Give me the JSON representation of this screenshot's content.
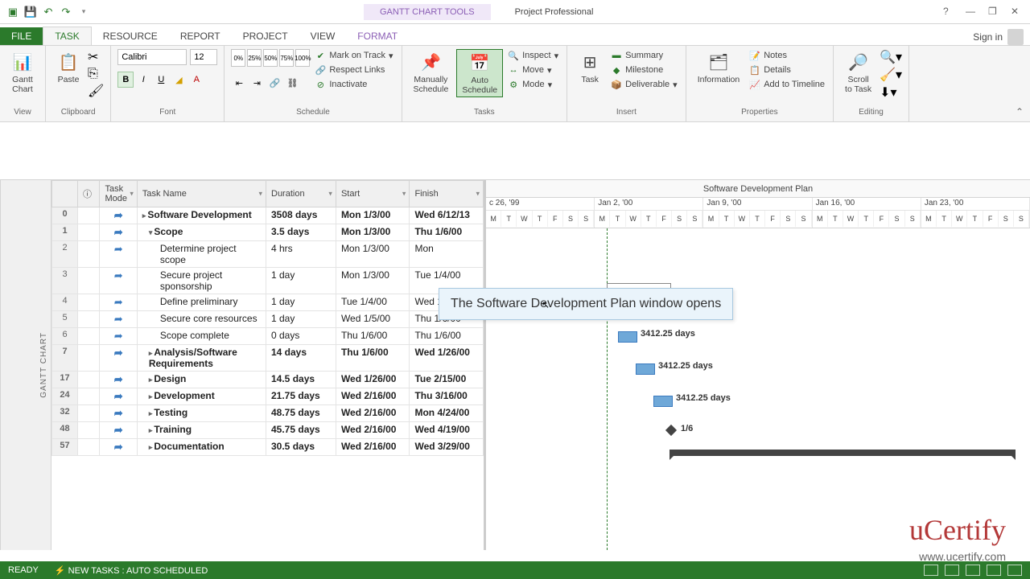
{
  "titleBar": {
    "toolContext": "GANTT CHART TOOLS",
    "appTitle": "Project Professional"
  },
  "tabs": {
    "file": "FILE",
    "task": "TASK",
    "resource": "RESOURCE",
    "report": "REPORT",
    "project": "PROJECT",
    "view": "VIEW",
    "format": "FORMAT",
    "signIn": "Sign in"
  },
  "ribbon": {
    "view": {
      "ganttChart": "Gantt\nChart",
      "title": "View"
    },
    "clipboard": {
      "paste": "Paste",
      "title": "Clipboard"
    },
    "font": {
      "name": "Calibri",
      "size": "12",
      "title": "Font"
    },
    "schedule": {
      "pct": [
        "0%",
        "25%",
        "50%",
        "75%",
        "100%"
      ],
      "markOnTrack": "Mark on Track",
      "respectLinks": "Respect Links",
      "inactivate": "Inactivate",
      "title": "Schedule"
    },
    "tasks": {
      "manually": "Manually\nSchedule",
      "auto": "Auto\nSchedule",
      "inspect": "Inspect",
      "move": "Move",
      "mode": "Mode",
      "title": "Tasks"
    },
    "insert": {
      "task": "Task",
      "summary": "Summary",
      "milestone": "Milestone",
      "deliverable": "Deliverable",
      "title": "Insert"
    },
    "properties": {
      "information": "Information",
      "notes": "Notes",
      "details": "Details",
      "addTimeline": "Add to Timeline",
      "title": "Properties"
    },
    "editing": {
      "scrollToTask": "Scroll\nto Task",
      "title": "Editing"
    }
  },
  "projectTitle": "Software Development Plan",
  "columns": {
    "info": "",
    "taskMode": "Task\nMode",
    "taskName": "Task Name",
    "duration": "Duration",
    "start": "Start",
    "finish": "Finish"
  },
  "timescale": {
    "weeks": [
      "c 26, '99",
      "Jan 2, '00",
      "Jan 9, '00",
      "Jan 16, '00",
      "Jan 23, '00"
    ],
    "days": [
      "M",
      "T",
      "W",
      "T",
      "F",
      "S",
      "S"
    ]
  },
  "rows": [
    {
      "n": "0",
      "name": "Software Development",
      "dur": "3508 days",
      "start": "Mon 1/3/00",
      "finish": "Wed 6/12/13",
      "bold": true,
      "indent": 0,
      "exp": "▸"
    },
    {
      "n": "1",
      "name": "Scope",
      "dur": "3.5 days",
      "start": "Mon 1/3/00",
      "finish": "Thu 1/6/00",
      "bold": true,
      "indent": 1,
      "exp": "▾"
    },
    {
      "n": "2",
      "name": "Determine project scope",
      "dur": "4 hrs",
      "start": "Mon 1/3/00",
      "finish": "Mon",
      "indent": 2
    },
    {
      "n": "3",
      "name": "Secure project sponsorship",
      "dur": "1 day",
      "start": "Mon 1/3/00",
      "finish": "Tue 1/4/00",
      "indent": 2
    },
    {
      "n": "4",
      "name": "Define preliminary",
      "dur": "1 day",
      "start": "Tue 1/4/00",
      "finish": "Wed 1/5/00",
      "indent": 2
    },
    {
      "n": "5",
      "name": "Secure core resources",
      "dur": "1 day",
      "start": "Wed 1/5/00",
      "finish": "Thu 1/6/00",
      "indent": 2
    },
    {
      "n": "6",
      "name": "Scope complete",
      "dur": "0 days",
      "start": "Thu 1/6/00",
      "finish": "Thu 1/6/00",
      "indent": 2
    },
    {
      "n": "7",
      "name": "Analysis/Software Requirements",
      "dur": "14 days",
      "start": "Thu 1/6/00",
      "finish": "Wed 1/26/00",
      "bold": true,
      "indent": 1,
      "exp": "▸"
    },
    {
      "n": "17",
      "name": "Design",
      "dur": "14.5 days",
      "start": "Wed 1/26/00",
      "finish": "Tue 2/15/00",
      "bold": true,
      "indent": 1,
      "exp": "▸"
    },
    {
      "n": "24",
      "name": "Development",
      "dur": "21.75 days",
      "start": "Wed 2/16/00",
      "finish": "Thu 3/16/00",
      "bold": true,
      "indent": 1,
      "exp": "▸"
    },
    {
      "n": "32",
      "name": "Testing",
      "dur": "48.75 days",
      "start": "Wed 2/16/00",
      "finish": "Mon 4/24/00",
      "bold": true,
      "indent": 1,
      "exp": "▸"
    },
    {
      "n": "48",
      "name": "Training",
      "dur": "45.75 days",
      "start": "Wed 2/16/00",
      "finish": "Wed 4/19/00",
      "bold": true,
      "indent": 1,
      "exp": "▸"
    },
    {
      "n": "57",
      "name": "Documentation",
      "dur": "30.5 days",
      "start": "Wed 2/16/00",
      "finish": "Wed 3/29/00",
      "bold": true,
      "indent": 1,
      "exp": "▸"
    }
  ],
  "ganttLabels": {
    "bar1": "3412.25 days",
    "bar2": "3412.25 days",
    "bar3": "3412.25 days",
    "milestone": "1/6"
  },
  "sideLabel": "GANTT CHART",
  "tooltip": {
    "textA": "The ",
    "textB": "Software Development Plan",
    "textC": " window opens"
  },
  "logo": {
    "brand": "uCertify",
    "url": "www.ucertify.com"
  },
  "status": {
    "ready": "READY",
    "newTasks": "NEW TASKS : AUTO SCHEDULED"
  }
}
